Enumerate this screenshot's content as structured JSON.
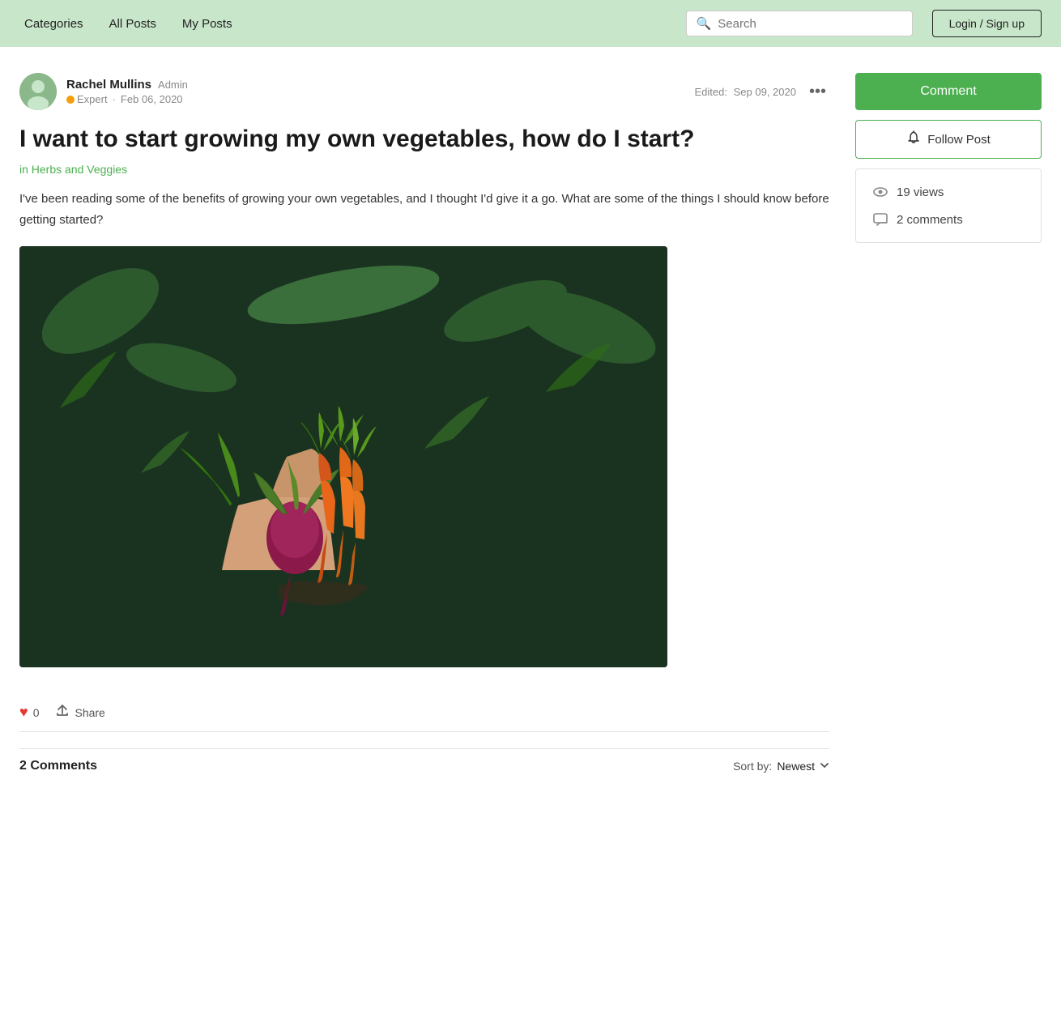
{
  "nav": {
    "categories_label": "Categories",
    "all_posts_label": "All Posts",
    "my_posts_label": "My Posts",
    "search_placeholder": "Search",
    "login_label": "Login / Sign up"
  },
  "post": {
    "author_name": "Rachel Mullins",
    "author_role": "Admin",
    "author_badge": "Expert",
    "author_date": "Feb 06, 2020",
    "edited_label": "Edited:",
    "edited_date": "Sep 09, 2020",
    "title": "I want to start growing my own vegetables, how do I start?",
    "category": "in Herbs and Veggies",
    "body": "I've been reading some of the benefits of growing your own vegetables, and I thought I'd give it a go. What are some of the things I should know before getting started?",
    "like_count": "0",
    "share_label": "Share",
    "comments_count_label": "2 Comments",
    "sort_label": "Sort by:",
    "sort_value": "Newest"
  },
  "sidebar": {
    "comment_btn_label": "Comment",
    "follow_btn_label": "Follow Post",
    "views_count": "19 views",
    "comments_count": "2 comments"
  },
  "icons": {
    "search": "🔍",
    "bell": "🔔",
    "heart": "♥",
    "share": "↗",
    "eye": "👁",
    "chat": "💬",
    "more": "⋯",
    "chevron_down": "⌄"
  }
}
